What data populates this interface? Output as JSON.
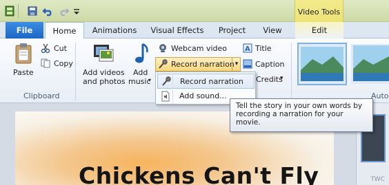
{
  "titlebar": {
    "context_tab": "Video Tools"
  },
  "tabs": {
    "file": "File",
    "home": "Home",
    "animations": "Animations",
    "visual_effects": "Visual Effects",
    "project": "Project",
    "view": "View",
    "edit": "Edit"
  },
  "clipboard": {
    "paste": "Paste",
    "cut": "Cut",
    "copy": "Copy",
    "group": "Clipboard"
  },
  "add": {
    "add_videos_line1": "Add videos",
    "add_videos_line2": "and photos",
    "add_music_line1": "Add",
    "add_music_line2": "music",
    "webcam": "Webcam video",
    "record": "Record narration",
    "title": "Title",
    "caption": "Caption",
    "credits": "Credits"
  },
  "themes_group": "Auto",
  "dropdown": {
    "item1": "Record narration",
    "item2": "Add sound..."
  },
  "tooltip": {
    "text": "Tell the story in your own words by recording a narration for your movie."
  },
  "preview": {
    "movie_title": "Chickens Can't Fly"
  },
  "watermark": "TWC"
}
